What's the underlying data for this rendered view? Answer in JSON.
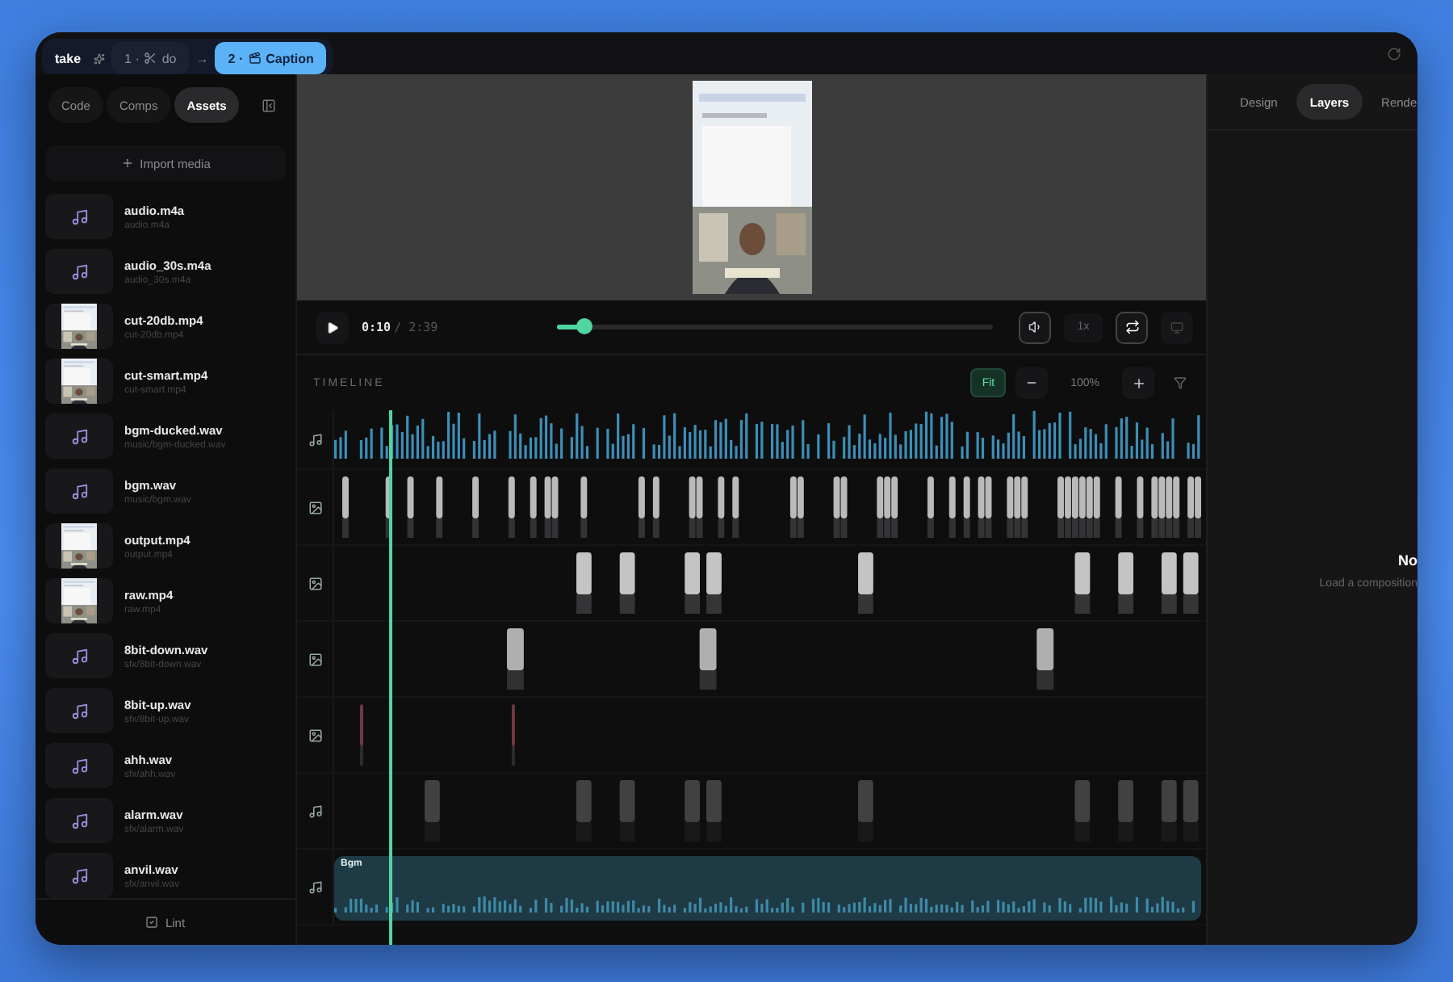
{
  "breadcrumb": {
    "project": "take",
    "steps": [
      {
        "index": "1 ·",
        "label": "do",
        "selected": false
      },
      {
        "index": "2 ·",
        "label": "Caption",
        "selected": true
      }
    ],
    "separator": "→"
  },
  "sidebar": {
    "tabs": [
      {
        "label": "Code",
        "selected": false
      },
      {
        "label": "Comps",
        "selected": false
      },
      {
        "label": "Assets",
        "selected": true
      }
    ],
    "import_label": "Import media",
    "assets": [
      {
        "kind": "audio",
        "name": "audio.m4a",
        "path": "audio.m4a"
      },
      {
        "kind": "audio",
        "name": "audio_30s.m4a",
        "path": "audio_30s.m4a"
      },
      {
        "kind": "video",
        "name": "cut-20db.mp4",
        "path": "cut-20db.mp4"
      },
      {
        "kind": "video",
        "name": "cut-smart.mp4",
        "path": "cut-smart.mp4"
      },
      {
        "kind": "audio",
        "name": "bgm-ducked.wav",
        "path": "music/bgm-ducked.wav"
      },
      {
        "kind": "audio",
        "name": "bgm.wav",
        "path": "music/bgm.wav"
      },
      {
        "kind": "video",
        "name": "output.mp4",
        "path": "output.mp4"
      },
      {
        "kind": "video",
        "name": "raw.mp4",
        "path": "raw.mp4"
      },
      {
        "kind": "audio",
        "name": "8bit-down.wav",
        "path": "sfx/8bit-down.wav"
      },
      {
        "kind": "audio",
        "name": "8bit-up.wav",
        "path": "sfx/8bit-up.wav"
      },
      {
        "kind": "audio",
        "name": "ahh.wav",
        "path": "sfx/ahh.wav"
      },
      {
        "kind": "audio",
        "name": "alarm.wav",
        "path": "sfx/alarm.wav"
      },
      {
        "kind": "audio",
        "name": "anvil.wav",
        "path": "sfx/anvil.wav"
      }
    ],
    "footer_button": "Lint"
  },
  "player": {
    "current": "0:10",
    "total": "/ 2:39",
    "level": 0.064,
    "speed": "1x",
    "loop_on": true
  },
  "timeline": {
    "title": "TIMELINE",
    "fit_label": "Fit",
    "fit_selected": true,
    "zoom": "100%",
    "tracks": [
      {
        "kind": "waveform"
      },
      {
        "kind": "dense"
      },
      {
        "kind": "sparse"
      },
      {
        "kind": "tall"
      },
      {
        "kind": "thin"
      },
      {
        "kind": "ghost"
      },
      {
        "kind": "clip",
        "label": "Bgm"
      }
    ]
  },
  "inspector": {
    "tabs": [
      {
        "label": "Design",
        "selected": false
      },
      {
        "label": "Layers",
        "selected": true
      },
      {
        "label": "Rende",
        "selected": false
      }
    ],
    "empty_title": "No",
    "empty_hint": "Load a composition"
  }
}
